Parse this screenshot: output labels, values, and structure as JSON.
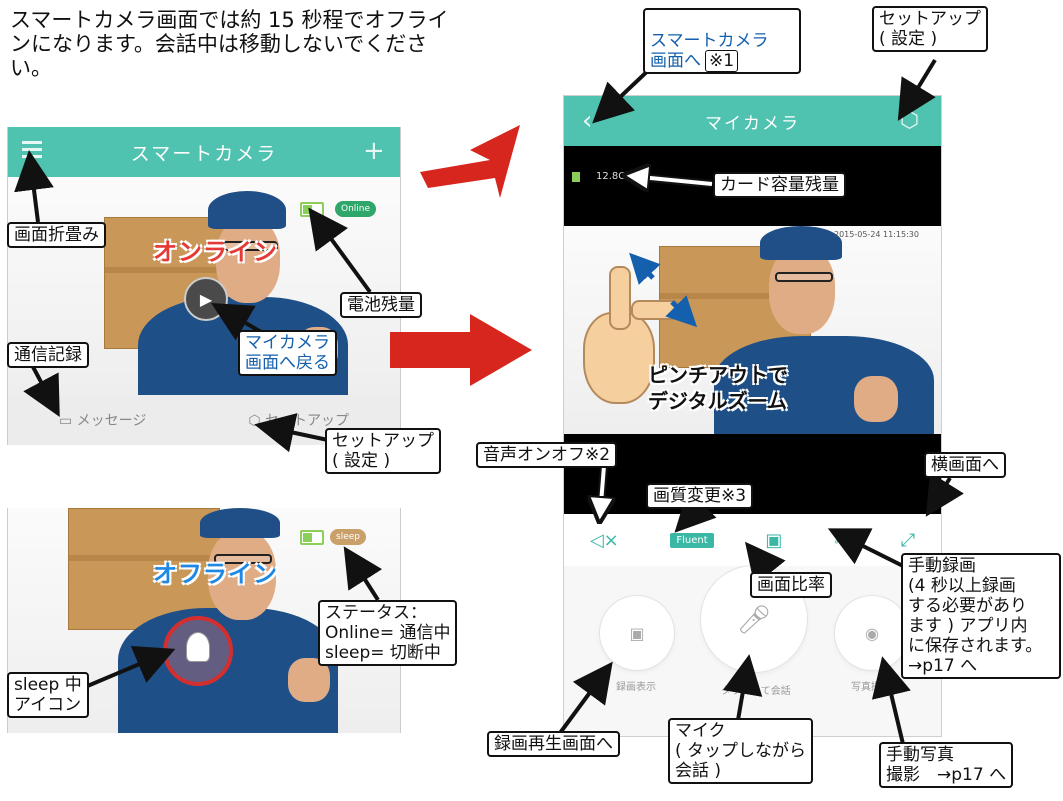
{
  "intro": "スマートカメラ画面では約 15 秒程でオフラインになります。会話中は移動しないでください。",
  "left_screen": {
    "title": "スマートカメラ",
    "status_pill": "Online",
    "online_label": "オンライン",
    "bottom_tabs": [
      "メッセージ",
      "セットアップ"
    ]
  },
  "offline_screen": {
    "status_pill": "sleep",
    "offline_label": "オフライン"
  },
  "right_screen": {
    "title": "マイカメラ",
    "card_text": "12.8G",
    "timestamp": "2015-05-24 11:15:30",
    "quality_button": "Fluent",
    "pinch_text": "ピンチアウトで\nデジタルズーム",
    "bottom_labels": [
      "録画表示",
      "タップして会話",
      "写真撮影"
    ]
  },
  "callouts": {
    "smart_camera": "スマートカメラ\n画面へ",
    "smart_camera_ref": "※1",
    "setup_top": "セットアップ\n( 設定 )",
    "card_remaining": "カード容量残量",
    "fold_screen": "画面折畳み",
    "battery": "電池残量",
    "back_to_mycamera": "マイカメラ\n画面へ戻る",
    "comm_log": "通信記録",
    "setup_left": "セットアップ\n( 設定 )",
    "audio": "音声オンオフ※2",
    "landscape": "横画面へ",
    "quality": "画質変更※3",
    "aspect": "画面比率",
    "manual_record": "手動録画\n(4 秒以上録画\nする必要があり\nます ) アプリ内\nに保存されます。\n→p17 へ",
    "status": "ステータス：\nOnline= 通信中\nsleep= 切断中",
    "sleep_icon": "sleep 中\nアイコン",
    "playback": "録画再生画面へ",
    "mic": "マイク\n( タップしながら\n会話 )",
    "manual_photo": "手動写真\n撮影　→p17 へ"
  },
  "colors": {
    "teal": "#4fc2b0",
    "online_red": "#e53935",
    "offline_blue": "#1e88e5",
    "arrow_red": "#d7261e",
    "text_blue": "#1560ad"
  }
}
